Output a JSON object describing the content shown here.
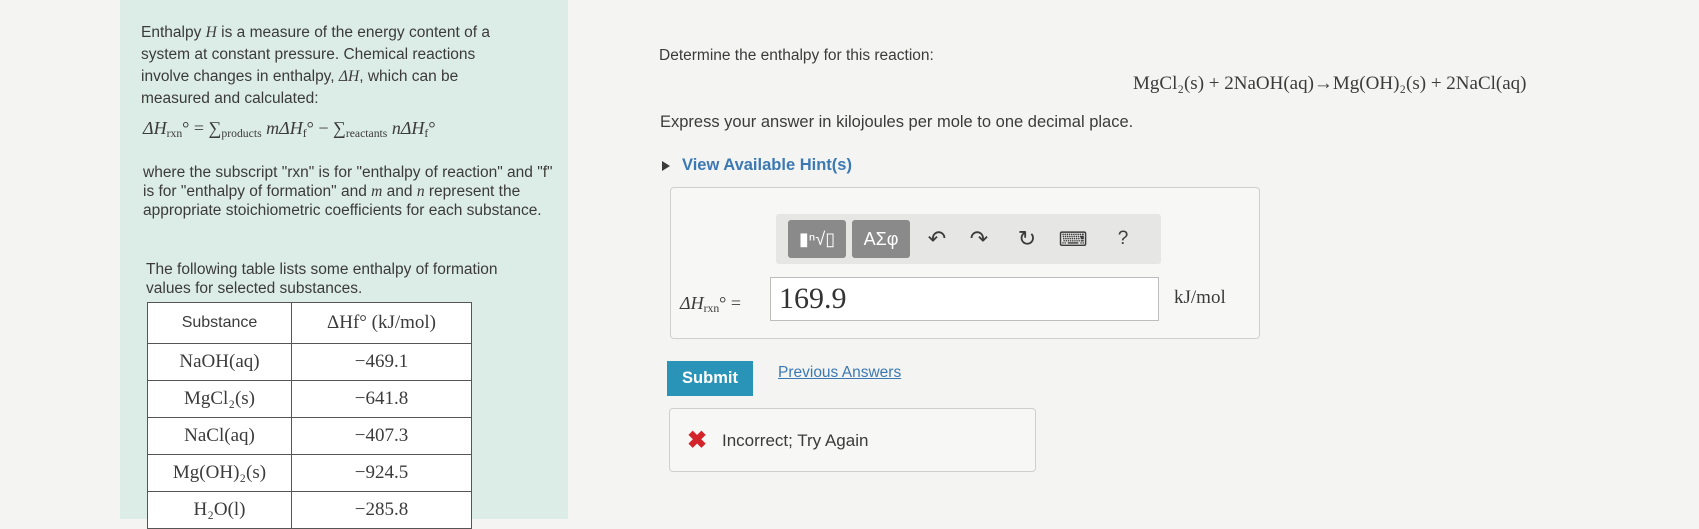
{
  "intro": {
    "p1_a": "Enthalpy ",
    "p1_sym": "H",
    "p1_b": " is a measure of the energy content of a system at constant pressure. Chemical reactions involve changes in enthalpy, ",
    "p1_delta": "ΔH",
    "p1_c": ", which can be measured and calculated:",
    "formula": {
      "lhs": "ΔH",
      "lhs_sub": "rxn",
      "deg": "°",
      "eq": " = ",
      "sum": "∑",
      "products": "products",
      "m": "m",
      "dh": "ΔH",
      "f": "f",
      "minus": " − ",
      "reactants": "reactants",
      "n": "n"
    },
    "p2_a": "where the subscript \"rxn\" is for \"enthalpy of reaction\" and \"f\" is for \"enthalpy of formation\" and ",
    "p2_m": "m",
    "p2_and": " and ",
    "p2_n": "n",
    "p2_b": " represent the appropriate stoichiometric coefficients for each substance.",
    "p3": "The following table lists some enthalpy of formation values for selected substances."
  },
  "table": {
    "header_substance": "Substance",
    "header_value": "ΔHf° (kJ/mol)",
    "rows": [
      {
        "substance": "NaOH(aq)",
        "value": "−469.1"
      },
      {
        "substance": "MgCl₂(s)",
        "value": "−641.8"
      },
      {
        "substance": "NaCl(aq)",
        "value": "−407.3"
      },
      {
        "substance": "Mg(OH)₂(s)",
        "value": "−924.5"
      },
      {
        "substance": "H₂O(l)",
        "value": "−285.8"
      }
    ]
  },
  "question": {
    "prompt": "Determine the enthalpy for this reaction:",
    "equation": "MgCl₂(s) + 2NaOH(aq)→Mg(OH)₂(s) + 2NaCl(aq)",
    "express": "Express your answer in kilojoules per mole to one decimal place.",
    "hints": "View Available Hint(s)"
  },
  "toolbar": {
    "templates": "▮ⁿ√▯",
    "symbols": "ΑΣφ",
    "undo": "↶",
    "redo": "↷",
    "reset": "↻",
    "keyboard": "⌨",
    "help": "?"
  },
  "answer": {
    "lhs": "ΔH",
    "lhs_sub": "rxn",
    "lhs_suffix": "° =",
    "value": "169.9",
    "units": "kJ/mol"
  },
  "actions": {
    "submit": "Submit",
    "previous": "Previous Answers"
  },
  "feedback": {
    "icon": "✖",
    "text": "Incorrect; Try Again"
  }
}
